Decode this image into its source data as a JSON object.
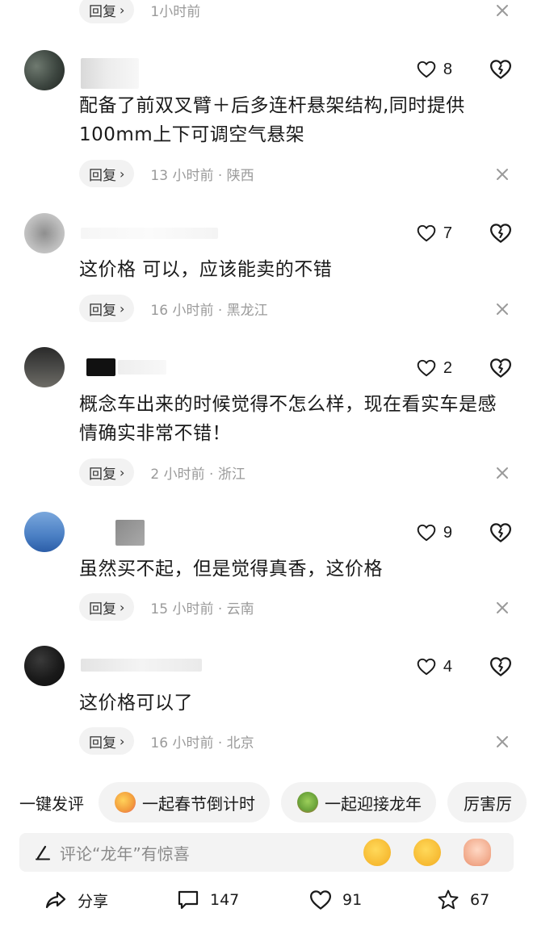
{
  "top_partial": {
    "reply_label": "回复",
    "meta": "1小时前"
  },
  "comments": [
    {
      "likes": "8",
      "text": "配备了前双叉臂＋后多连杆悬架结构,同时提供100mm上下可调空气悬架",
      "reply_label": "回复",
      "meta": "13 小时前 · 陕西"
    },
    {
      "likes": "7",
      "text": "这价格 可以，应该能卖的不错",
      "reply_label": "回复",
      "meta": "16 小时前 · 黑龙江"
    },
    {
      "likes": "2",
      "text": "概念车出来的时候觉得不怎么样，现在看实车是感情确实非常不错！",
      "reply_label": "回复",
      "meta": "2 小时前 · 浙江"
    },
    {
      "likes": "9",
      "text": "虽然买不起，但是觉得真香，这价格",
      "reply_label": "回复",
      "meta": "15 小时前 · 云南"
    },
    {
      "likes": "4",
      "text": "这价格可以了",
      "reply_label": "回复",
      "meta": "16 小时前 · 北京"
    }
  ],
  "quick_reply": {
    "label": "一键发评",
    "chips": [
      "一起春节倒计时",
      "一起迎接龙年",
      "厉害厉"
    ]
  },
  "input": {
    "placeholder": "评论“龙年”有惊喜"
  },
  "actions": {
    "share": "分享",
    "comments": "147",
    "likes": "91",
    "favorites": "67"
  },
  "colors": {
    "meta_gray": "#9a9a9a",
    "chip_bg": "#f2f2f2",
    "text": "#1a1a1a"
  }
}
